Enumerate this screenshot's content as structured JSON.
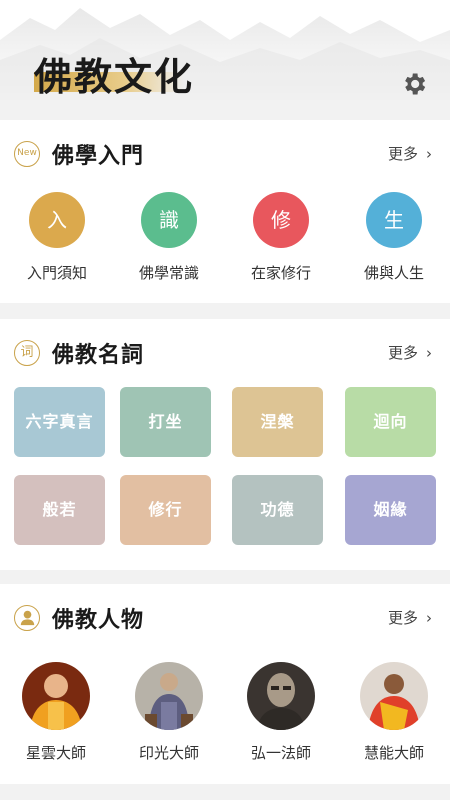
{
  "header": {
    "title": "佛教文化",
    "settings_icon": "gear-icon"
  },
  "intro": {
    "icon_text": "New",
    "title": "佛學入門",
    "more": "更多",
    "items": [
      {
        "char": "入",
        "label": "入門須知",
        "color": "#dba94d"
      },
      {
        "char": "識",
        "label": "佛學常識",
        "color": "#5bbd8e"
      },
      {
        "char": "修",
        "label": "在家修行",
        "color": "#e8575d"
      },
      {
        "char": "生",
        "label": "佛與人生",
        "color": "#54b0d8"
      }
    ]
  },
  "terms": {
    "icon_text": "词",
    "title": "佛教名詞",
    "more": "更多",
    "items": [
      {
        "label": "六字真言",
        "color": "#a8c8d4"
      },
      {
        "label": "打坐",
        "color": "#9fc4b4"
      },
      {
        "label": "涅槃",
        "color": "#ddc494"
      },
      {
        "label": "迴向",
        "color": "#b8dca6"
      },
      {
        "label": "般若",
        "color": "#d4c0be"
      },
      {
        "label": "修行",
        "color": "#e2bfa2"
      },
      {
        "label": "功德",
        "color": "#b4c2c0"
      },
      {
        "label": "姻緣",
        "color": "#a6a6d2"
      }
    ]
  },
  "people": {
    "icon_text": "person-icon",
    "title": "佛教人物",
    "more": "更多",
    "items": [
      {
        "label": "星雲大師"
      },
      {
        "label": "印光大師"
      },
      {
        "label": "弘一法師"
      },
      {
        "label": "慧能大師"
      }
    ]
  }
}
